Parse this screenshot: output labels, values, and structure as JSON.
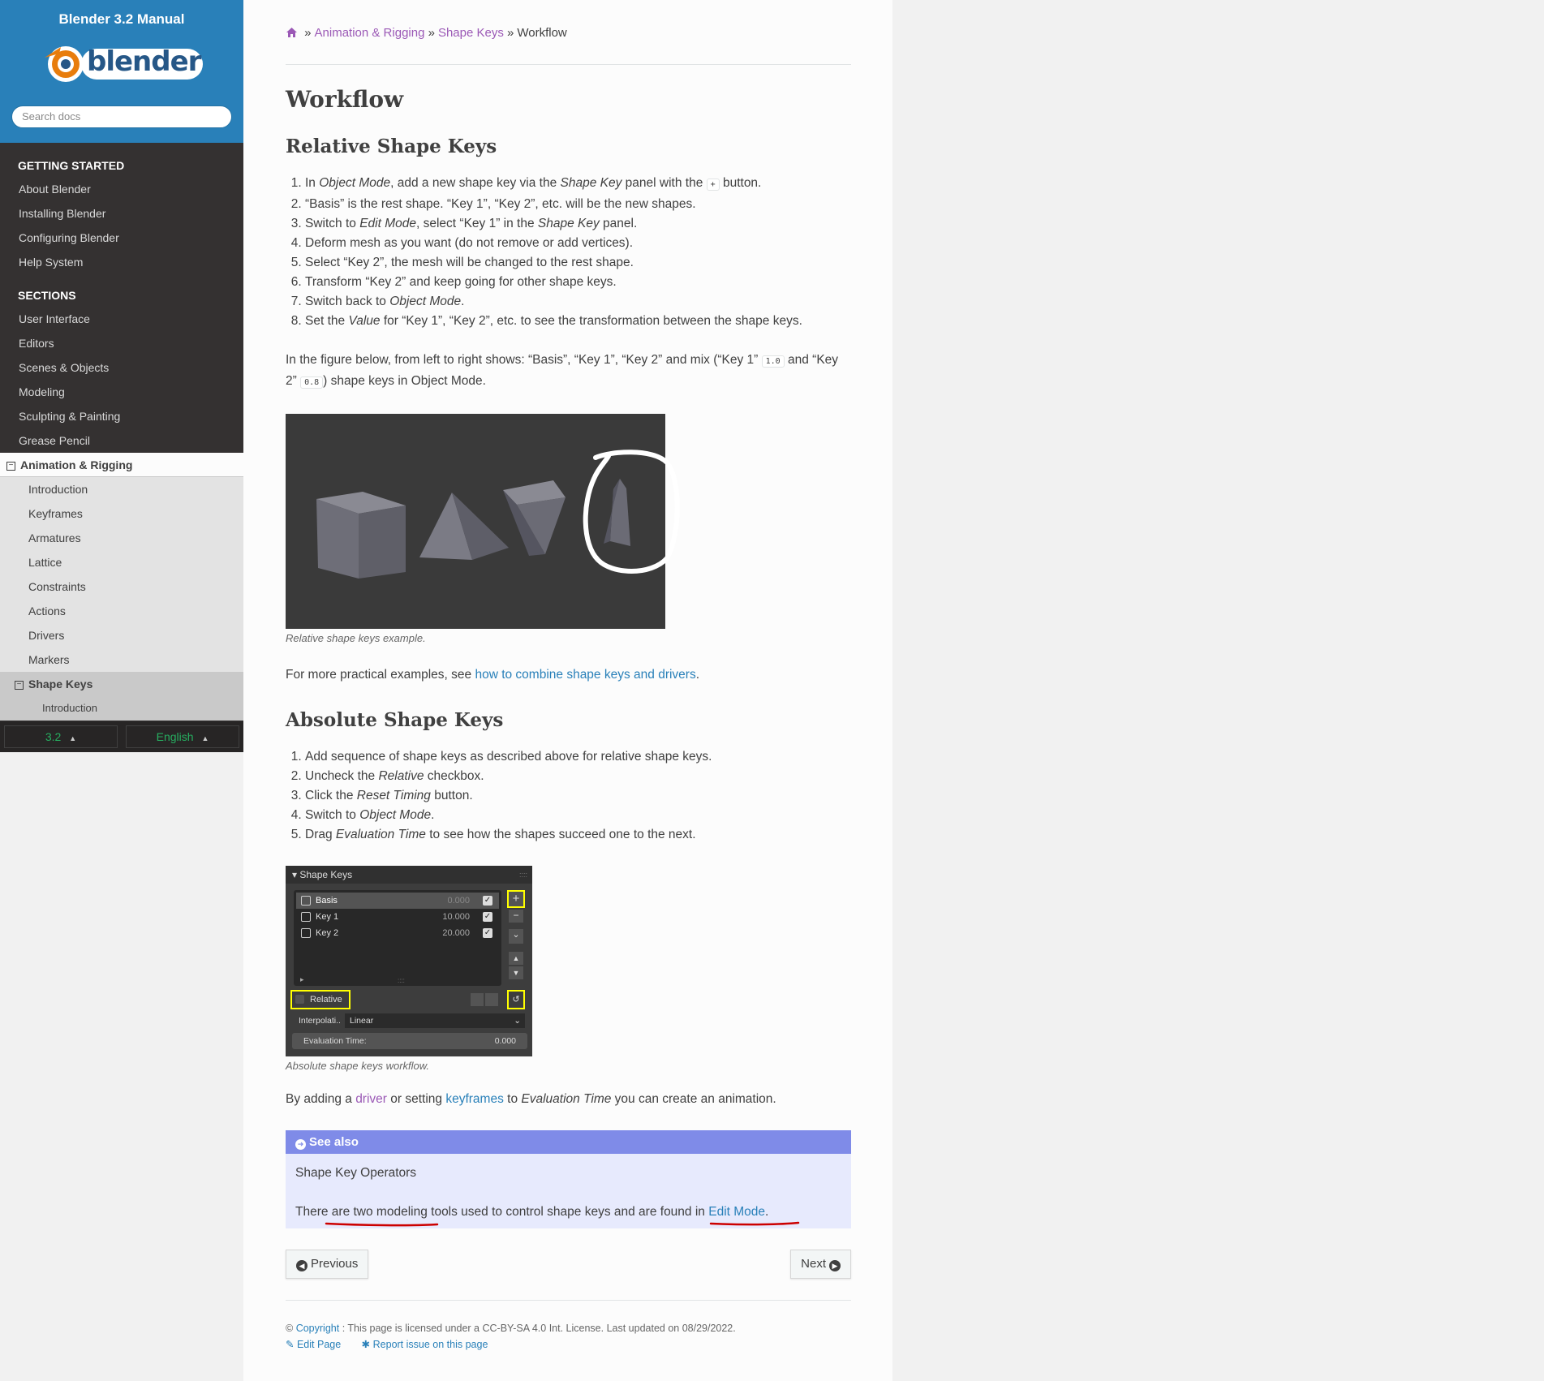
{
  "sidebar": {
    "title": "Blender 3.2 Manual",
    "logo_text": "blender",
    "search_placeholder": "Search docs",
    "caption_started": "GETTING STARTED",
    "started": [
      "About Blender",
      "Installing Blender",
      "Configuring Blender",
      "Help System"
    ],
    "caption_sections": "SECTIONS",
    "sections": [
      "User Interface",
      "Editors",
      "Scenes & Objects",
      "Modeling",
      "Sculpting & Painting",
      "Grease Pencil"
    ],
    "current": "Animation & Rigging",
    "sub": [
      "Introduction",
      "Keyframes",
      "Armatures",
      "Lattice",
      "Constraints",
      "Actions",
      "Drivers",
      "Markers"
    ],
    "sub_current": "Shape Keys",
    "sub_sub": [
      "Introduction"
    ],
    "version": "3.2",
    "language": "English",
    "toggle_symbol": "⊟",
    "caret": "▲"
  },
  "breadcrumb": {
    "home_icon": "home-icon",
    "sep": "»",
    "items": [
      "Animation & Rigging",
      "Shape Keys"
    ],
    "current": "Workflow"
  },
  "page": {
    "title": "Workflow",
    "h_relative": "Relative Shape Keys",
    "relative_steps": [
      [
        "In ",
        "Object Mode",
        ", add a new shape key via the ",
        "Shape Key",
        " panel with the ",
        "+",
        " button."
      ],
      [
        "“Basis” is the rest shape. “Key 1”, “Key 2”, etc. will be the new shapes."
      ],
      [
        "Switch to ",
        "Edit Mode",
        ", select “Key 1” in the ",
        "Shape Key",
        " panel."
      ],
      [
        "Deform mesh as you want (do not remove or add vertices)."
      ],
      [
        "Select “Key 2”, the mesh will be changed to the rest shape."
      ],
      [
        "Transform “Key 2” and keep going for other shape keys."
      ],
      [
        "Switch back to ",
        "Object Mode",
        "."
      ],
      [
        "Set the ",
        "Value",
        " for “Key 1”, “Key 2”, etc. to see the transformation between the shape keys."
      ]
    ],
    "figure_intro": [
      "In the figure below, from left to right shows: “Basis”, “Key 1”, “Key 2” and mix (“Key 1” ",
      "1.0",
      " and “Key 2” ",
      "0.8",
      ") shape keys in Object Mode."
    ],
    "fig1_caption": "Relative shape keys example.",
    "practical": [
      "For more practical examples, see ",
      "how to combine shape keys and drivers",
      "."
    ],
    "h_absolute": "Absolute Shape Keys",
    "absolute_steps": [
      [
        "Add sequence of shape keys as described above for relative shape keys."
      ],
      [
        "Uncheck the ",
        "Relative",
        " checkbox."
      ],
      [
        "Click the ",
        "Reset Timing",
        " button."
      ],
      [
        "Switch to ",
        "Object Mode",
        "."
      ],
      [
        "Drag ",
        "Evaluation Time",
        " to see how the shapes succeed one to the next."
      ]
    ],
    "fig2_caption": "Absolute shape keys workflow.",
    "anim_text": [
      "By adding a ",
      "driver",
      " or setting ",
      "keyframes",
      " to ",
      "Evaluation Time",
      " you can create an animation."
    ],
    "seealso_title": "See also",
    "seealso_line1": "Shape Key Operators",
    "seealso_line2": [
      "There are two modeling tools used to control shape keys and are found in ",
      "Edit Mode",
      "."
    ],
    "prev": "Previous",
    "next": "Next"
  },
  "panel": {
    "title": "Shape Keys",
    "rows": [
      {
        "name": "Basis",
        "value": "0.000"
      },
      {
        "name": "Key 1",
        "value": "10.000"
      },
      {
        "name": "Key 2",
        "value": "20.000"
      }
    ],
    "relative": "Relative",
    "interp_label": "Interpolati..",
    "interp_value": "Linear",
    "eval_label": "Evaluation Time:",
    "eval_value": "0.000",
    "add_symbol": "+",
    "remove_symbol": "−",
    "menu_symbol": "⌄",
    "up_symbol": "▲",
    "down_symbol": "▼",
    "expand_symbol": "▸",
    "grip_symbol": "::::",
    "reset_symbol": "↺",
    "dropdown_symbol": "⌄"
  },
  "footer": {
    "copyright_symbol": "©",
    "copyright_link": "Copyright",
    "copyright_rest": ": This page is licensed under a CC-BY-SA 4.0 Int. License. Last updated on 08/29/2022.",
    "edit": "Edit Page",
    "report": "Report issue on this page"
  },
  "colors": {
    "sidebar_blue": "#2980b9",
    "link": "#2980b9",
    "visited": "#9b59b6",
    "admon_header": "#7f8be8",
    "annotation_red": "#cc0000",
    "highlight_yellow": "#ffff00"
  }
}
